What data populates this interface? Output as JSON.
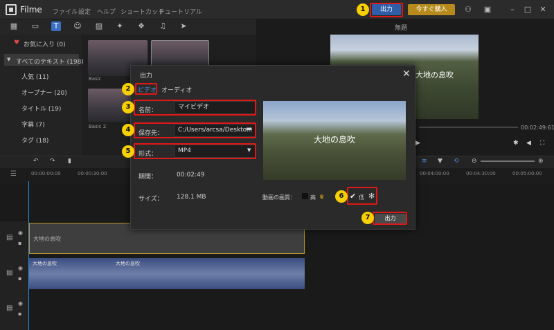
{
  "app": {
    "title": "Filme"
  },
  "menu": [
    "ファイル",
    "設定",
    "ヘルプ",
    "ショートカット",
    "チュートリアル"
  ],
  "toolbar": {
    "export_label": "出力",
    "buy_label": "今すぐ購入"
  },
  "sidebar": {
    "items": [
      {
        "label": "お気に入り (0)"
      },
      {
        "label": "すべてのテキスト (198)"
      },
      {
        "label": "人気 (11)"
      },
      {
        "label": "オープナー (20)"
      },
      {
        "label": "タイトル (19)"
      },
      {
        "label": "字幕 (7)"
      },
      {
        "label": "タグ (18)"
      }
    ]
  },
  "thumbnails": [
    {
      "label": "Basic"
    },
    {
      "label": "Basic 2"
    }
  ],
  "preview": {
    "title": "無題",
    "overlay_text": "大地の息吹",
    "time": "00:02:49:61"
  },
  "timeline": {
    "ruler": [
      "00:00:00:00",
      "00:00:30:00",
      "00:04:00:00",
      "00:04:30:00",
      "00:05:00:00"
    ],
    "text_clip_label": "大地の息吹",
    "video_labels": [
      "大地の息吹",
      "大地の息吹"
    ]
  },
  "dialog": {
    "title": "出力",
    "tabs": [
      "ビデオ",
      "オーディオ"
    ],
    "name_label": "名前：",
    "name_value": "マイビデオ",
    "save_label": "保存先：",
    "save_value": "C:/Users/arcsa/Deskto...",
    "format_label": "形式：",
    "format_value": "MP4",
    "duration_label": "期間：",
    "duration_value": "00:02:49",
    "size_label": "サイズ：",
    "size_value": "128.1 MB",
    "preview_text": "大地の息吹",
    "quality_label": "動画の画質：",
    "quality_high": "高",
    "quality_low": "低",
    "export_button": "出力"
  },
  "badges": [
    "1",
    "2",
    "3",
    "4",
    "5",
    "6",
    "7"
  ],
  "colors": {
    "accent": "#2f5ea8",
    "highlight": "#e01818",
    "badge": "#f6d000",
    "buy": "#b78a1c"
  }
}
